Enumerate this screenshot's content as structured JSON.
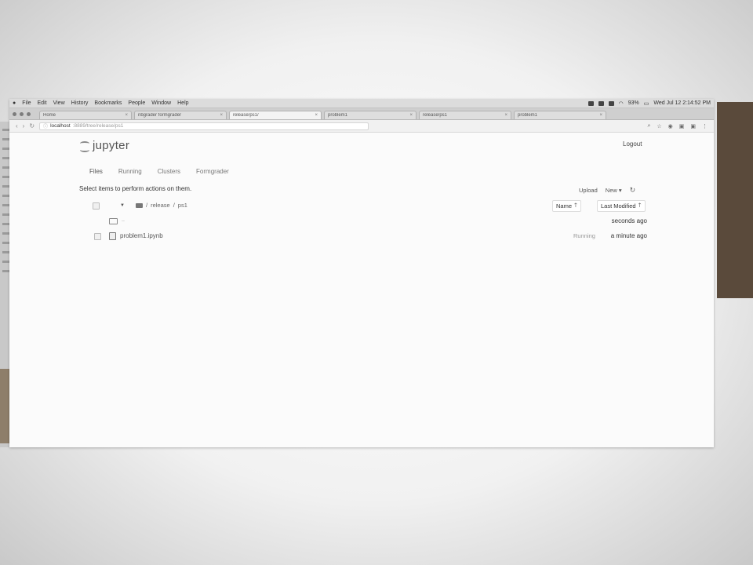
{
  "menubar": {
    "items": [
      "File",
      "Edit",
      "View",
      "History",
      "Bookmarks",
      "People",
      "Window",
      "Help"
    ],
    "battery": "93%",
    "clock": "Wed Jul 12 2:14:52 PM"
  },
  "browser": {
    "tabs": [
      {
        "label": "Home",
        "active": false
      },
      {
        "label": "nbgrader formgrader",
        "active": false
      },
      {
        "label": "release/ps1/",
        "active": true
      },
      {
        "label": "problem1",
        "active": false
      },
      {
        "label": "release/ps1",
        "active": false
      },
      {
        "label": "problem1",
        "active": false
      }
    ],
    "url_host": "localhost",
    "url_path": ":8889/tree/release/ps1"
  },
  "jupyter": {
    "logo_text": "jupyter",
    "logout": "Logout",
    "tabs": [
      "Files",
      "Running",
      "Clusters",
      "Formgrader"
    ],
    "select_hint": "Select items to perform actions on them.",
    "upload": "Upload",
    "new": "New",
    "breadcrumb": [
      "release",
      "ps1"
    ],
    "sort_name": "Name",
    "sort_modified": "Last Modified",
    "rows": [
      {
        "name": "..",
        "status": "",
        "modified": "seconds ago"
      },
      {
        "name": "problem1.ipynb",
        "status": "Running",
        "modified": "a minute ago"
      }
    ]
  }
}
